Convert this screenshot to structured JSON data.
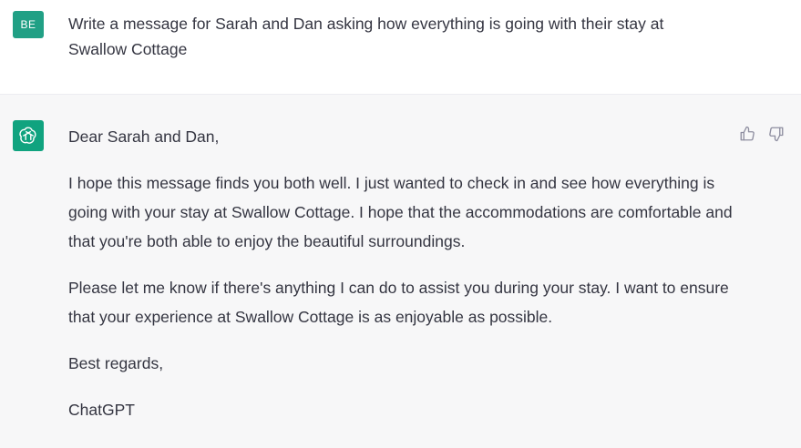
{
  "user_message": {
    "avatar_initials": "BE",
    "text": "Write a message for Sarah and Dan asking how everything is going with their stay at Swallow Cottage"
  },
  "assistant_message": {
    "avatar_icon": "openai-logo-icon",
    "paragraphs": [
      "Dear Sarah and Dan,",
      "I hope this message finds you both well. I just wanted to check in and see how everything is going with your stay at Swallow Cottage. I hope that the accommodations are comfortable and that you're both able to enjoy the beautiful surroundings.",
      "Please let me know if there's anything I can do to assist you during your stay. I want to ensure that your experience at Swallow Cottage is as enjoyable as possible.",
      "Best regards,",
      "ChatGPT"
    ],
    "feedback": {
      "like_icon": "thumbs-up-icon",
      "dislike_icon": "thumbs-down-icon"
    }
  },
  "colors": {
    "user_avatar": "#21a085",
    "bot_avatar": "#10a37f",
    "assistant_bg": "#f7f7f8",
    "text": "#343541"
  }
}
